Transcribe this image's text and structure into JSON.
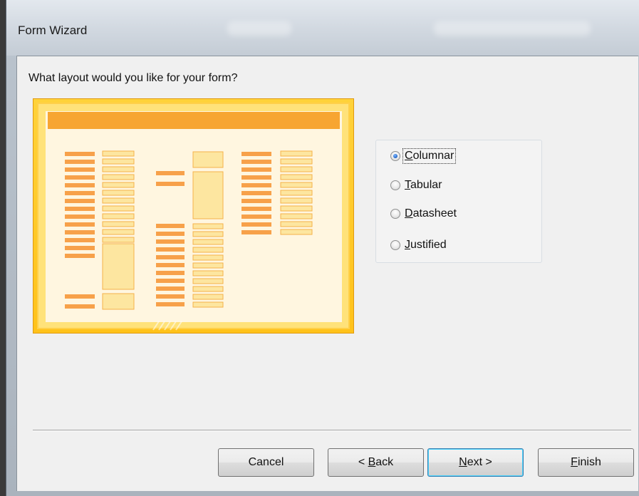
{
  "window": {
    "title": "Form Wizard"
  },
  "prompt": "What layout would you like for your form?",
  "layout_options": [
    {
      "label": "Columnar",
      "accel": "C",
      "rest": "olumnar",
      "selected": true
    },
    {
      "label": "Tabular",
      "accel": "T",
      "rest": "abular",
      "selected": false
    },
    {
      "label": "Datasheet",
      "accel": "D",
      "rest": "atasheet",
      "selected": false
    },
    {
      "label": "Justified",
      "accel": "J",
      "rest": "ustified",
      "selected": false
    }
  ],
  "buttons": {
    "cancel": {
      "label": "Cancel"
    },
    "back": {
      "pre": "< ",
      "accel": "B",
      "rest": "ack"
    },
    "next": {
      "accel": "N",
      "rest": "ext >"
    },
    "finish": {
      "accel": "F",
      "rest": "inish"
    }
  },
  "colors": {
    "preview_frame": "#ffc21a",
    "preview_bg": "#fff6e0",
    "field_label": "#f7a14a",
    "field_box": "#fde6a0",
    "title_bar": "#f7a532"
  }
}
